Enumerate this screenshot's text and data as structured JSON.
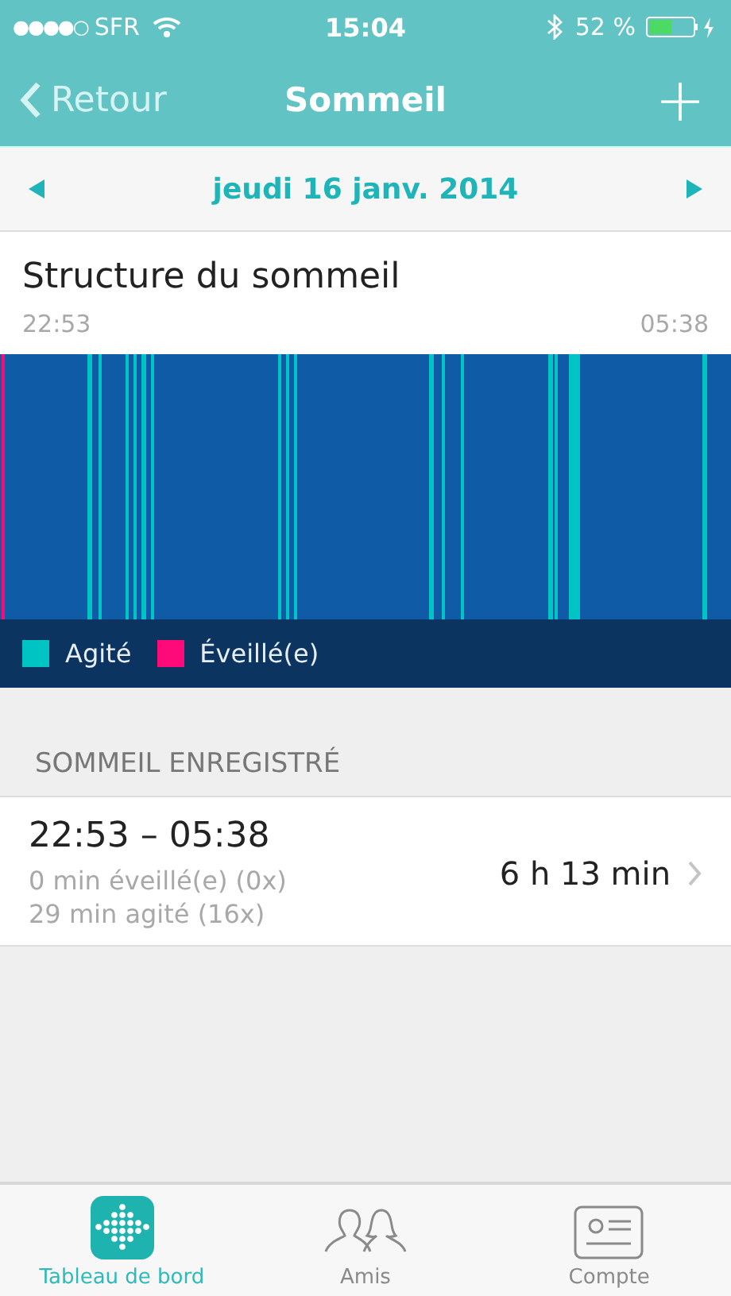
{
  "status_bar": {
    "signal": "●●●●○",
    "carrier": "SFR",
    "time": "15:04",
    "battery": {
      "reading": "52 %",
      "level": 0.52
    }
  },
  "nav": {
    "back": "Retour",
    "title": "Sommeil",
    "add": "+"
  },
  "date_bar": {
    "date": "jeudi 16 janv. 2014"
  },
  "structure": {
    "title": "Structure du sommeil",
    "start": "22:53",
    "end": "05:38",
    "legend": [
      {
        "label": "Agité",
        "color": "#00c3c3"
      },
      {
        "label": "Éveillé(e)",
        "color": "#ff0a78"
      }
    ]
  },
  "section_header": "SOMMEIL ENREGISTRÉ",
  "records": [
    {
      "range": "22:53 – 05:38",
      "awake": "0 min éveillé(e) (0x)",
      "restless": "29 min agité (16x)",
      "duration": "6 h 13 min"
    }
  ],
  "tabs": [
    {
      "label": "Tableau de bord",
      "kind": "dashboard",
      "selected": true
    },
    {
      "label": "Amis",
      "kind": "friends",
      "selected": false
    },
    {
      "label": "Compte",
      "kind": "account",
      "selected": false
    }
  ]
}
